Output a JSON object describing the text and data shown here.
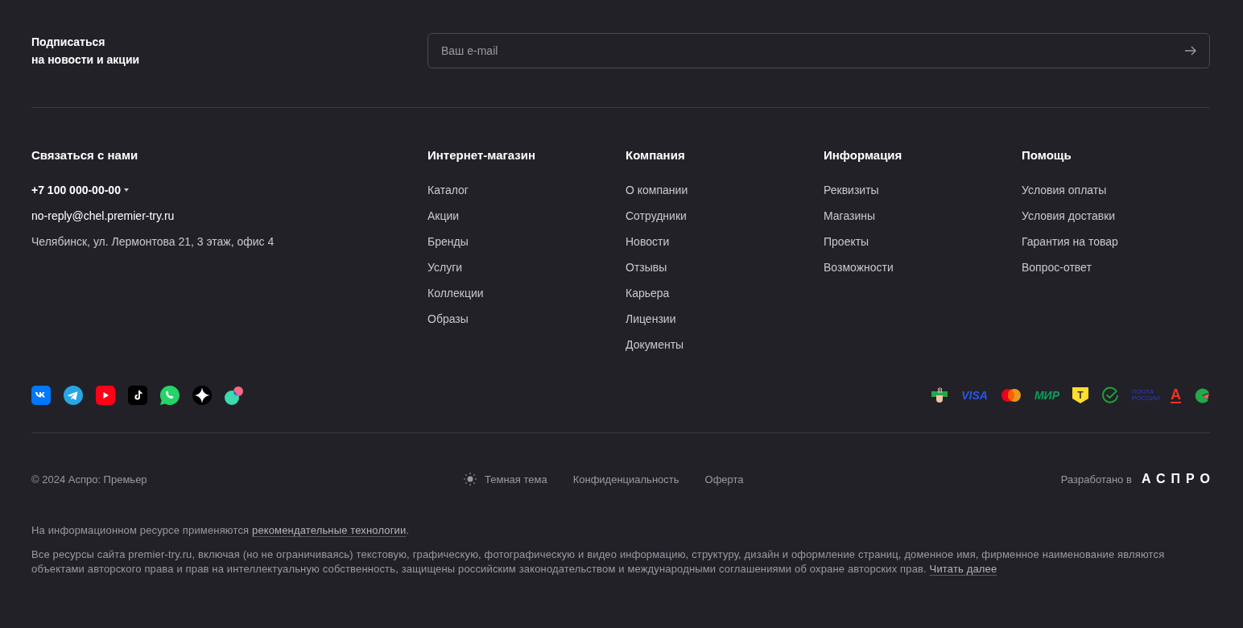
{
  "subscribe": {
    "title_lines": [
      "Подписаться",
      "на новости и акции"
    ],
    "placeholder": "Ваш e-mail"
  },
  "contacts": {
    "title": "Связаться с нами",
    "phone": "+7 100 000-00-00",
    "email": "no-reply@chel.premier-try.ru",
    "address": "Челябинск, ул. Лермонтова 21, 3 этаж, офис 4"
  },
  "menus": [
    {
      "title": "Интернет-магазин",
      "items": [
        "Каталог",
        "Акции",
        "Бренды",
        "Услуги",
        "Коллекции",
        "Образы"
      ]
    },
    {
      "title": "Компания",
      "items": [
        "О компании",
        "Сотрудники",
        "Новости",
        "Отзывы",
        "Карьера",
        "Лицензии",
        "Документы"
      ]
    },
    {
      "title": "Информация",
      "items": [
        "Реквизиты",
        "Магазины",
        "Проекты",
        "Возможности"
      ]
    },
    {
      "title": "Помощь",
      "items": [
        "Условия оплаты",
        "Условия доставки",
        "Гарантия на товар",
        "Вопрос-ответ"
      ]
    }
  ],
  "socials": [
    {
      "kind": "vk"
    },
    {
      "kind": "telegram"
    },
    {
      "kind": "youtube"
    },
    {
      "kind": "tiktok"
    },
    {
      "kind": "whatsapp"
    },
    {
      "kind": "star"
    },
    {
      "kind": "circles"
    }
  ],
  "payments": [
    {
      "kind": "hand"
    },
    {
      "kind": "visa",
      "label": "VISA"
    },
    {
      "kind": "mastercard"
    },
    {
      "kind": "mir",
      "label": "МИР"
    },
    {
      "kind": "shield",
      "label": "Т"
    },
    {
      "kind": "check"
    },
    {
      "kind": "post",
      "label": "ПОЧТА РОССИИ"
    },
    {
      "kind": "alfa",
      "label": "А"
    },
    {
      "kind": "melon"
    }
  ],
  "bottom": {
    "copyright": "© 2024 Аспро: Премьер",
    "theme_label": "Темная тема",
    "links": [
      "Конфиденциальность",
      "Оферта"
    ],
    "developed_by": "Разработано в",
    "developer_logo": "АСПРО"
  },
  "notice": {
    "before": "На информационном ресурсе применяются ",
    "link": "рекомендательные технологии",
    "after": "."
  },
  "legal": {
    "text": "Все ресурсы сайта premier-try.ru, включая (но не ограничиваясь) текстовую, графическую, фотографическую и видео информацию, структуру, дизайн и оформление страниц, доменное имя, фирменное наименование являются объектами авторского права и прав на интеллектуальную собственность, защищены российским законодательством и международными соглашениями об охране авторских прав. ",
    "link": "Читать далее"
  }
}
